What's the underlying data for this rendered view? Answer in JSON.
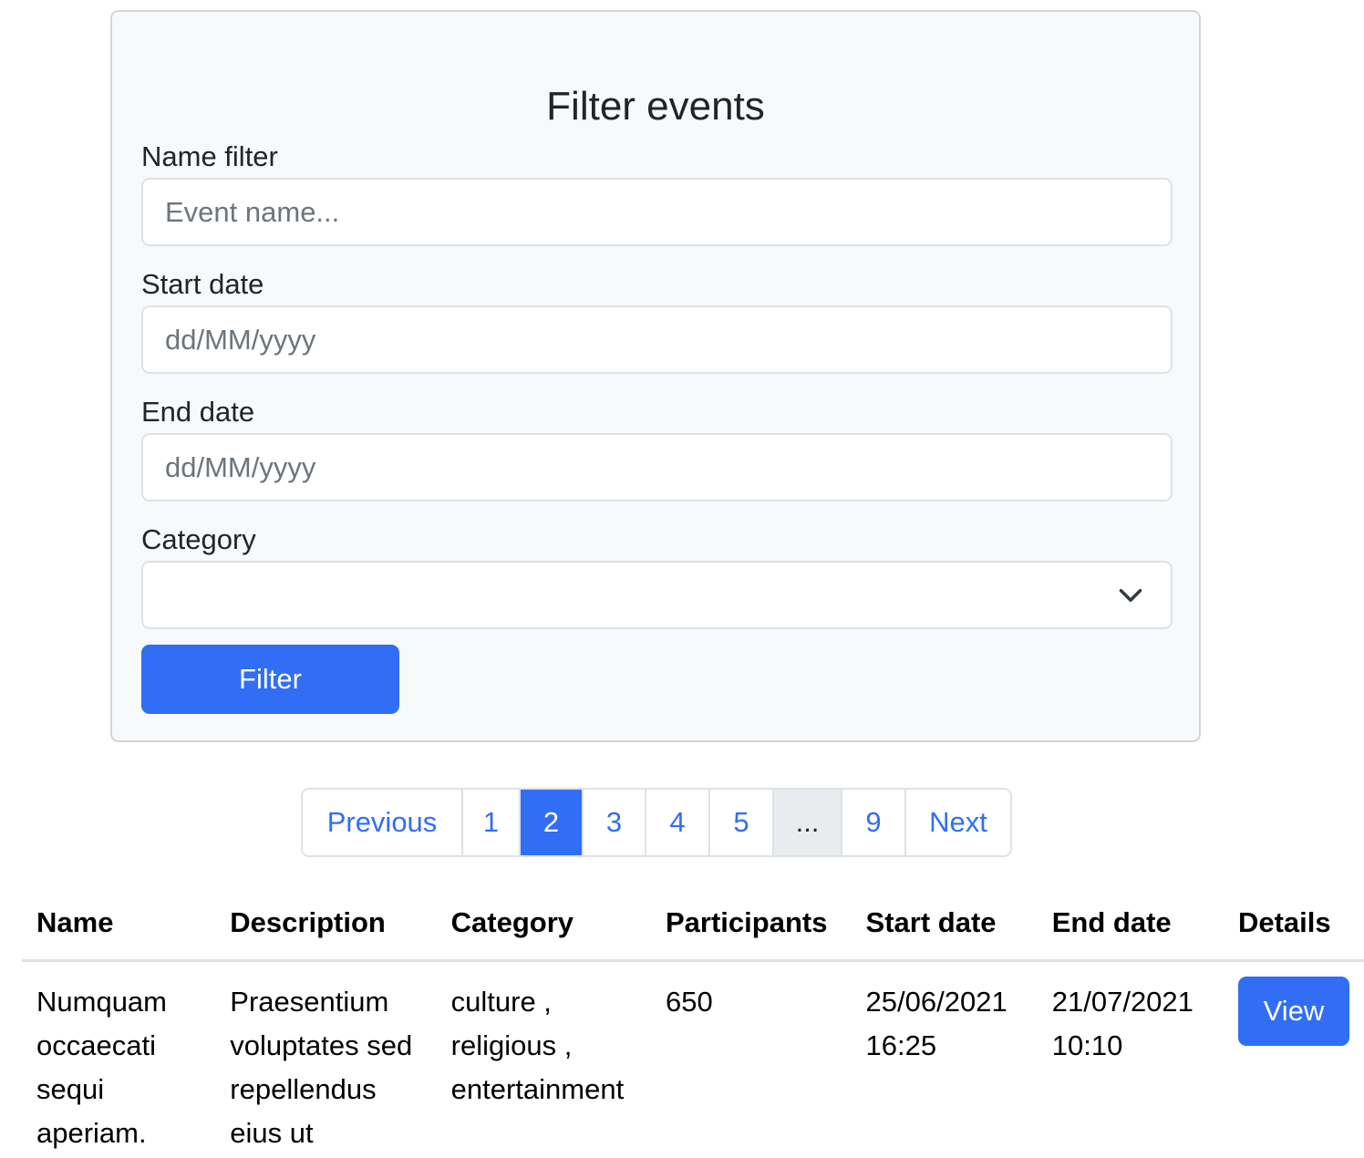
{
  "filter_card": {
    "title": "Filter events",
    "name_filter": {
      "label": "Name filter",
      "placeholder": "Event name..."
    },
    "start_date": {
      "label": "Start date",
      "placeholder": "dd/MM/yyyy"
    },
    "end_date": {
      "label": "End date",
      "placeholder": "dd/MM/yyyy"
    },
    "category": {
      "label": "Category",
      "value": ""
    },
    "filter_button": "Filter"
  },
  "pagination": {
    "previous": "Previous",
    "pages": [
      "1",
      "2",
      "3",
      "4",
      "5"
    ],
    "active_page": "2",
    "ellipsis": "...",
    "last_page": "9",
    "next": "Next"
  },
  "table": {
    "headers": [
      "Name",
      "Description",
      "Category",
      "Participants",
      "Start date",
      "End date",
      "Details"
    ],
    "rows": [
      {
        "name_lines": [
          "Numquam",
          "occaecati",
          "sequi",
          "aperiam."
        ],
        "description_lines": [
          "Praesentium",
          "voluptates sed",
          "repellendus",
          "eius ut"
        ],
        "category_lines": [
          "culture ,",
          "religious ,",
          "entertainment"
        ],
        "participants": "650",
        "start_date_lines": [
          "25/06/2021",
          "16:25"
        ],
        "end_date_lines": [
          "21/07/2021",
          "10:10"
        ],
        "details_button": "View"
      }
    ]
  },
  "colors": {
    "primary": "#316ef5",
    "card_background": "#f8f9fa",
    "border": "#dee2e6"
  }
}
